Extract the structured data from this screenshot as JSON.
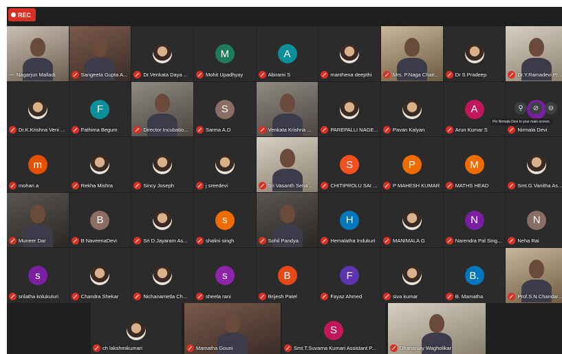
{
  "recording_label": "REC",
  "tooltip": "Pin Nirmala Devi to your main screen.",
  "overlay_icons": [
    "pin-icon",
    "mic-off-icon",
    "remove-icon"
  ],
  "rows": [
    [
      {
        "name": "Nagarjun Malladi",
        "type": "cam",
        "style": "c2",
        "muted": false,
        "dots": true
      },
      {
        "name": "Sangeeta Gupta A...",
        "type": "cam",
        "style": "c1",
        "muted": true
      },
      {
        "name": "Dr.Venkata Daya ...",
        "type": "photo",
        "muted": true
      },
      {
        "name": "Mohit Upadhyay",
        "type": "letter",
        "letter": "M",
        "color": "#1e7c5a",
        "muted": true
      },
      {
        "name": "Abirami S",
        "type": "letter",
        "letter": "A",
        "color": "#0b8f99",
        "muted": true
      },
      {
        "name": "manthena deepthi",
        "type": "photo",
        "muted": true
      },
      {
        "name": "Mrs. P.Naga Chait...",
        "type": "cam",
        "style": "c6",
        "muted": true
      },
      {
        "name": "Dr S Pradeep",
        "type": "photo",
        "muted": true
      },
      {
        "name": "Dr.Y.Ramadevi Pr...",
        "type": "cam",
        "style": "c4",
        "muted": true
      }
    ],
    [
      {
        "name": "Dr.K.Krishna Veni ...",
        "type": "photo",
        "muted": true
      },
      {
        "name": "Fathima Begum",
        "type": "letter",
        "letter": "F",
        "color": "#0b8f99",
        "muted": true
      },
      {
        "name": "Director Incubatio...",
        "type": "cam",
        "style": "c3",
        "muted": true
      },
      {
        "name": "Sarma A.D",
        "type": "letter",
        "letter": "S",
        "color": "#8a6d63",
        "muted": true
      },
      {
        "name": "Venkata Krishna ...",
        "type": "cam",
        "style": "c3",
        "muted": true
      },
      {
        "name": "PAREPALLI NAGE...",
        "type": "photo",
        "muted": true
      },
      {
        "name": "Pavan Kalyan",
        "type": "photo",
        "muted": true
      },
      {
        "name": "Arun Kumar S",
        "type": "letter",
        "letter": "A",
        "color": "#c2185b",
        "muted": true
      },
      {
        "name": "Nirmala Devi",
        "type": "letter",
        "letter": "N",
        "color": "#7b1fa2",
        "muted": true
      }
    ],
    [
      {
        "name": "mohan a",
        "type": "letter",
        "letter": "m",
        "color": "#e65100",
        "muted": true
      },
      {
        "name": "Rekha Mishra",
        "type": "photo",
        "muted": true
      },
      {
        "name": "Sincy Joseph",
        "type": "photo",
        "muted": true
      },
      {
        "name": "j sreedevi",
        "type": "photo",
        "muted": true
      },
      {
        "name": "Sri Vasanth Sena ...",
        "type": "cam",
        "style": "c4",
        "muted": true
      },
      {
        "name": "CHITIPROLU SAI ...",
        "type": "letter",
        "letter": "S",
        "color": "#f4511e",
        "muted": true
      },
      {
        "name": "P MAHESH KUMAR",
        "type": "letter",
        "letter": "P",
        "color": "#ef6c00",
        "muted": true
      },
      {
        "name": "MATHS HEAD",
        "type": "letter",
        "letter": "M",
        "color": "#ef6c00",
        "muted": true
      },
      {
        "name": "Smt.G.Vanitha As...",
        "type": "photo",
        "muted": true
      }
    ],
    [
      {
        "name": "Muneer Dar",
        "type": "cam",
        "style": "c5",
        "muted": true
      },
      {
        "name": "B NaveenaDevi",
        "type": "letter",
        "letter": "B",
        "color": "#8a6d63",
        "muted": true
      },
      {
        "name": "Sri D.Jayaram As...",
        "type": "photo",
        "muted": true
      },
      {
        "name": "shalini singh",
        "type": "letter",
        "letter": "s",
        "color": "#ef6c00",
        "muted": true
      },
      {
        "name": "Sohil Pandya",
        "type": "cam",
        "style": "c5",
        "muted": true
      },
      {
        "name": "Hemalatha Indukuri",
        "type": "letter",
        "letter": "H",
        "color": "#0277bd",
        "muted": true
      },
      {
        "name": "MANIMALA G",
        "type": "photo",
        "muted": true
      },
      {
        "name": "Narendra Pal Sing...",
        "type": "letter",
        "letter": "N",
        "color": "#7b1fa2",
        "muted": true
      },
      {
        "name": "Neha Rai",
        "type": "letter",
        "letter": "N",
        "color": "#8a6d63",
        "muted": true
      }
    ],
    [
      {
        "name": "srilatha kolukuluri",
        "type": "letter",
        "letter": "s",
        "color": "#7b1fa2",
        "muted": true
      },
      {
        "name": "Chandra Shekar",
        "type": "photo",
        "muted": true
      },
      {
        "name": "Nichanametla Ch...",
        "type": "photo",
        "muted": true
      },
      {
        "name": "sheela rani",
        "type": "letter",
        "letter": "s",
        "color": "#8e24aa",
        "muted": true
      },
      {
        "name": "Brijesh Patel",
        "type": "letter",
        "letter": "B",
        "color": "#e64a19",
        "muted": true
      },
      {
        "name": "Fayaz Ahmed",
        "type": "letter",
        "letter": "F",
        "color": "#5e35b1",
        "muted": true
      },
      {
        "name": "siva kumar",
        "type": "photo",
        "muted": true
      },
      {
        "name": "B. Mamatha",
        "type": "letter",
        "letter": "B.",
        "color": "#0277bd",
        "muted": true
      },
      {
        "name": "Prof.S.N.Chandar...",
        "type": "cam",
        "style": "c6",
        "muted": true
      }
    ]
  ],
  "bottom_row": [
    {
      "name": "ch lakshmikumari",
      "type": "photo",
      "muted": true
    },
    {
      "name": "Mamatha Gouni",
      "type": "cam",
      "style": "c1",
      "muted": true
    },
    {
      "name": "Smt.T.Suvarna Kumari Assistant P...",
      "type": "letter",
      "letter": "S",
      "color": "#c2185b",
      "muted": true
    },
    {
      "name": "Dhananjay Wagholikar",
      "type": "cam",
      "style": "c4",
      "muted": true
    }
  ]
}
